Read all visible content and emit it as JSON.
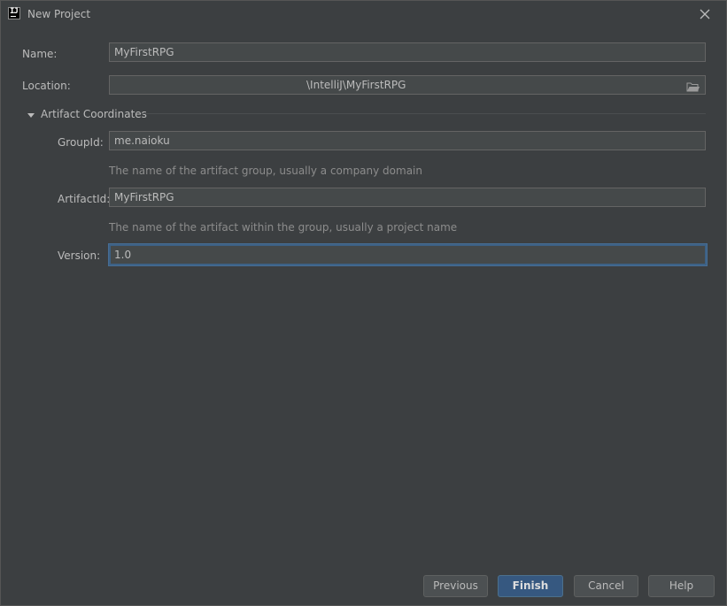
{
  "window": {
    "title": "New Project",
    "app_icon_glyph": "IJ",
    "app_icon_name": "intellij-icon",
    "close_icon_name": "close-icon"
  },
  "form": {
    "name": {
      "label": "Name:",
      "value": "MyFirstRPG"
    },
    "location": {
      "label": "Location:",
      "value": "\\IntelliJ\\MyFirstRPG",
      "browse_icon_name": "folder-icon"
    },
    "artifact_section": {
      "label": "Artifact Coordinates",
      "expanded": true,
      "group_id": {
        "label": "GroupId:",
        "value": "me.naioku",
        "hint": "The name of the artifact group, usually a company domain"
      },
      "artifact_id": {
        "label": "ArtifactId:",
        "value": "MyFirstRPG",
        "hint": "The name of the artifact within the group, usually a project name"
      },
      "version": {
        "label": "Version:",
        "value": "1.0"
      }
    }
  },
  "buttons": {
    "previous": "Previous",
    "finish": "Finish",
    "cancel": "Cancel",
    "help": "Help"
  },
  "colors": {
    "background": "#3c3f41",
    "field_background": "#45494a",
    "primary_button": "#365880",
    "focus_border": "#3d6185"
  }
}
